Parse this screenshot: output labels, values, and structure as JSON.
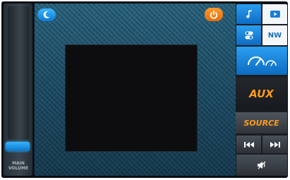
{
  "volume": {
    "label_line1": "MAIN",
    "label_line2": "VOLUME",
    "level_fraction": 0.05
  },
  "top_bar": {
    "night_mode_icon": "crescent-moon-icon",
    "power_icon": "power-icon"
  },
  "main": {
    "video_area": "blank-black"
  },
  "sidebar": {
    "music_icon": "music-note-icon",
    "video_icon": "video-play-icon",
    "settings_icon": "toggle-switches-icon",
    "nw_label": "NW",
    "gauge_icon": "speedometer-icon",
    "mode_label": "AUX",
    "source_label": "SOURCE",
    "prev_icon": "skip-previous-icon",
    "next_icon": "skip-next-icon",
    "mute_icon": "speaker-mute-icon"
  },
  "colors": {
    "accent_blue": "#1a86db",
    "accent_orange": "#ff9a1a",
    "background_blue": "#1f5069"
  }
}
